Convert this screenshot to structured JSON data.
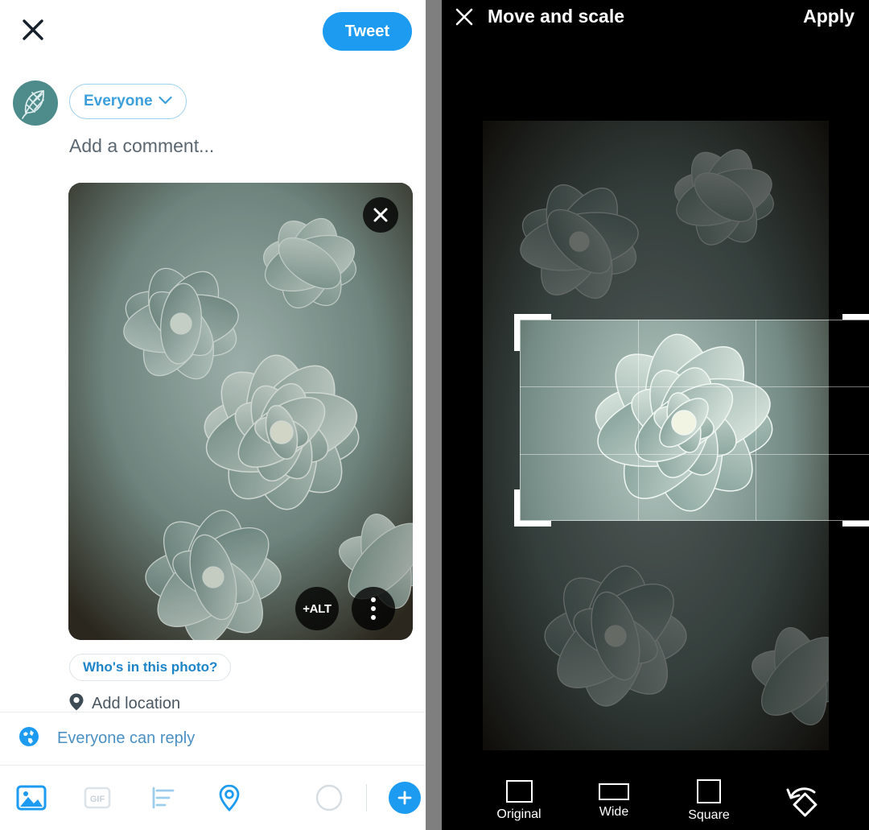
{
  "compose": {
    "close_icon": "close-icon",
    "tweet_label": "Tweet",
    "avatar_icon": "leaf-avatar-icon",
    "audience_label": "Everyone",
    "audience_chevron": "chevron-down-icon",
    "comment_placeholder": "Add a comment...",
    "photo": {
      "remove_icon": "close-icon",
      "alt_label": "+ALT",
      "menu_icon": "more-vertical-icon"
    },
    "tag_people_label": "Who's in this photo?",
    "location_icon": "location-pin-icon",
    "add_location_label": "Add location",
    "reply_icon": "globe-icon",
    "reply_label": "Everyone can reply",
    "toolbar": {
      "image_icon": "image-icon",
      "gif_icon": "gif-icon",
      "poll_icon": "poll-icon",
      "location_icon": "location-pin-icon",
      "progress_icon": "character-count-ring-icon",
      "add_icon": "plus-icon"
    },
    "accent_color": "#1d9bf0",
    "muted_color": "#5b6770"
  },
  "cropper": {
    "close_icon": "close-icon",
    "title": "Move and scale",
    "apply_label": "Apply",
    "aspect_options": [
      {
        "label": "Original",
        "icon": "rect-original-icon"
      },
      {
        "label": "Wide",
        "icon": "rect-wide-icon"
      },
      {
        "label": "Square",
        "icon": "rect-square-icon"
      }
    ],
    "rotate_icon": "rotate-icon",
    "background_color": "#000000",
    "frame_color": "#ffffff"
  }
}
